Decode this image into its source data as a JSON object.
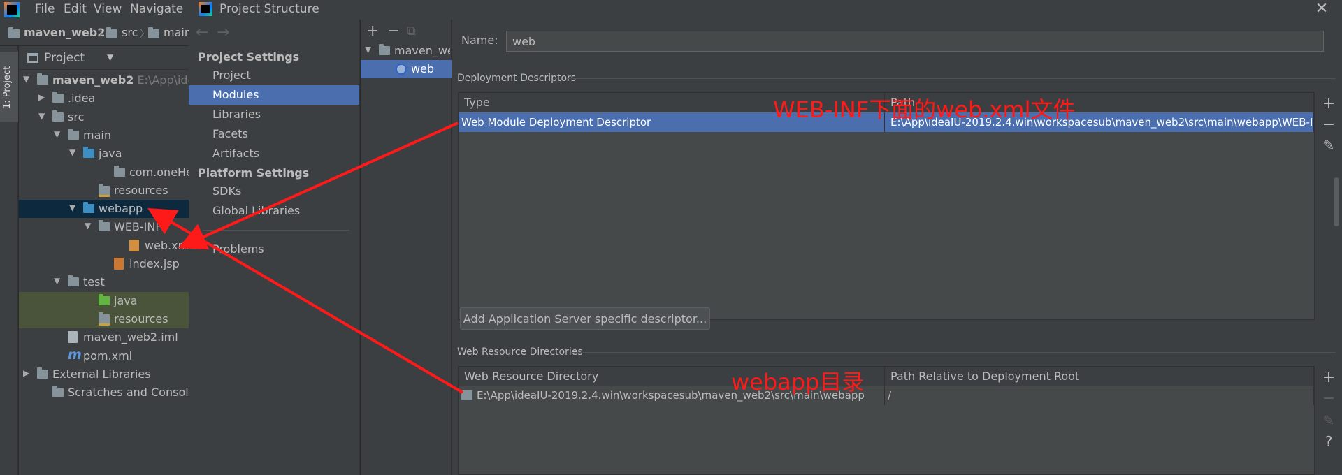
{
  "ide": {
    "menu": [
      "File",
      "Edit",
      "View",
      "Navigate"
    ],
    "breadcrumb": [
      "maven_web2",
      "src",
      "main"
    ],
    "project_tab": "1: Project",
    "project_view": "Project",
    "tree": [
      {
        "label": "maven_web2",
        "hint": "E:\\App\\idea",
        "indent": 0,
        "arrow": "down",
        "icon": "module-folder",
        "bold": true
      },
      {
        "label": ".idea",
        "indent": 1,
        "arrow": "right",
        "icon": "folder"
      },
      {
        "label": "src",
        "indent": 1,
        "arrow": "down",
        "icon": "folder"
      },
      {
        "label": "main",
        "indent": 2,
        "arrow": "down",
        "icon": "folder"
      },
      {
        "label": "java",
        "indent": 3,
        "arrow": "down",
        "icon": "source-folder"
      },
      {
        "label": "com.oneHeart",
        "indent": 5,
        "arrow": "",
        "icon": "package"
      },
      {
        "label": "resources",
        "indent": 4,
        "arrow": "",
        "icon": "resources-folder"
      },
      {
        "label": "webapp",
        "indent": 3,
        "arrow": "down",
        "icon": "web-folder",
        "selected": true
      },
      {
        "label": "WEB-INF",
        "indent": 4,
        "arrow": "down",
        "icon": "folder"
      },
      {
        "label": "web.xml",
        "indent": 6,
        "arrow": "",
        "icon": "xml-file"
      },
      {
        "label": "index.jsp",
        "indent": 5,
        "arrow": "",
        "icon": "jsp-file"
      },
      {
        "label": "test",
        "indent": 2,
        "arrow": "down",
        "icon": "folder"
      },
      {
        "label": "java",
        "indent": 4,
        "arrow": "",
        "icon": "test-folder",
        "test": true
      },
      {
        "label": "resources",
        "indent": 4,
        "arrow": "",
        "icon": "test-resources-folder",
        "test": true
      },
      {
        "label": "maven_web2.iml",
        "indent": 2,
        "arrow": "",
        "icon": "iml-file"
      },
      {
        "label": "pom.xml",
        "indent": 2,
        "arrow": "",
        "icon": "maven-file"
      },
      {
        "label": "External Libraries",
        "indent": 0,
        "arrow": "right",
        "icon": "library"
      },
      {
        "label": "Scratches and Consoles",
        "indent": 1,
        "arrow": "",
        "icon": "scratches"
      }
    ]
  },
  "dialog": {
    "title": "Project Structure",
    "close": "✕",
    "nav": {
      "back": "←",
      "forward": "→"
    },
    "sidebar": {
      "project_settings_header": "Project Settings",
      "project_settings": [
        "Project",
        "Modules",
        "Libraries",
        "Facets",
        "Artifacts"
      ],
      "platform_settings_header": "Platform Settings",
      "platform_settings": [
        "SDKs",
        "Global Libraries"
      ],
      "problems": "Problems",
      "selected": "Modules"
    },
    "modules": {
      "tools": {
        "add": "+",
        "remove": "−",
        "copy": "⧉"
      },
      "items": [
        {
          "label": "maven_web",
          "icon": "module-folder-icon"
        },
        {
          "label": "web",
          "icon": "web-facet-icon",
          "selected": true
        }
      ]
    },
    "detail": {
      "name_label": "Name:",
      "name_value": "web",
      "descriptors": {
        "title": "Deployment Descriptors",
        "columns": [
          "Type",
          "Path"
        ],
        "rows": [
          {
            "type": "Web Module Deployment Descriptor",
            "path": "E:\\App\\ideaIU-2019.2.4.win\\workspacesub\\maven_web2\\src\\main\\webapp\\WEB-IN"
          }
        ],
        "tools": {
          "add": "+",
          "remove": "−",
          "edit": "✎"
        }
      },
      "add_server_button": "Add Application Server specific descriptor...",
      "resources": {
        "title": "Web Resource Directories",
        "columns": [
          "Web Resource Directory",
          "Path Relative to Deployment Root"
        ],
        "rows": [
          {
            "directory": "E:\\App\\ideaIU-2019.2.4.win\\workspacesub\\maven_web2\\src\\main\\webapp",
            "relative": "/"
          }
        ],
        "tools": {
          "add": "+",
          "remove": "−",
          "edit": "✎",
          "help": "?"
        }
      }
    }
  },
  "annotations": {
    "webinf_note": "WEB-INF下面的web.xml文件",
    "webapp_note": "webapp目录",
    "color": "#ff1a1a"
  }
}
